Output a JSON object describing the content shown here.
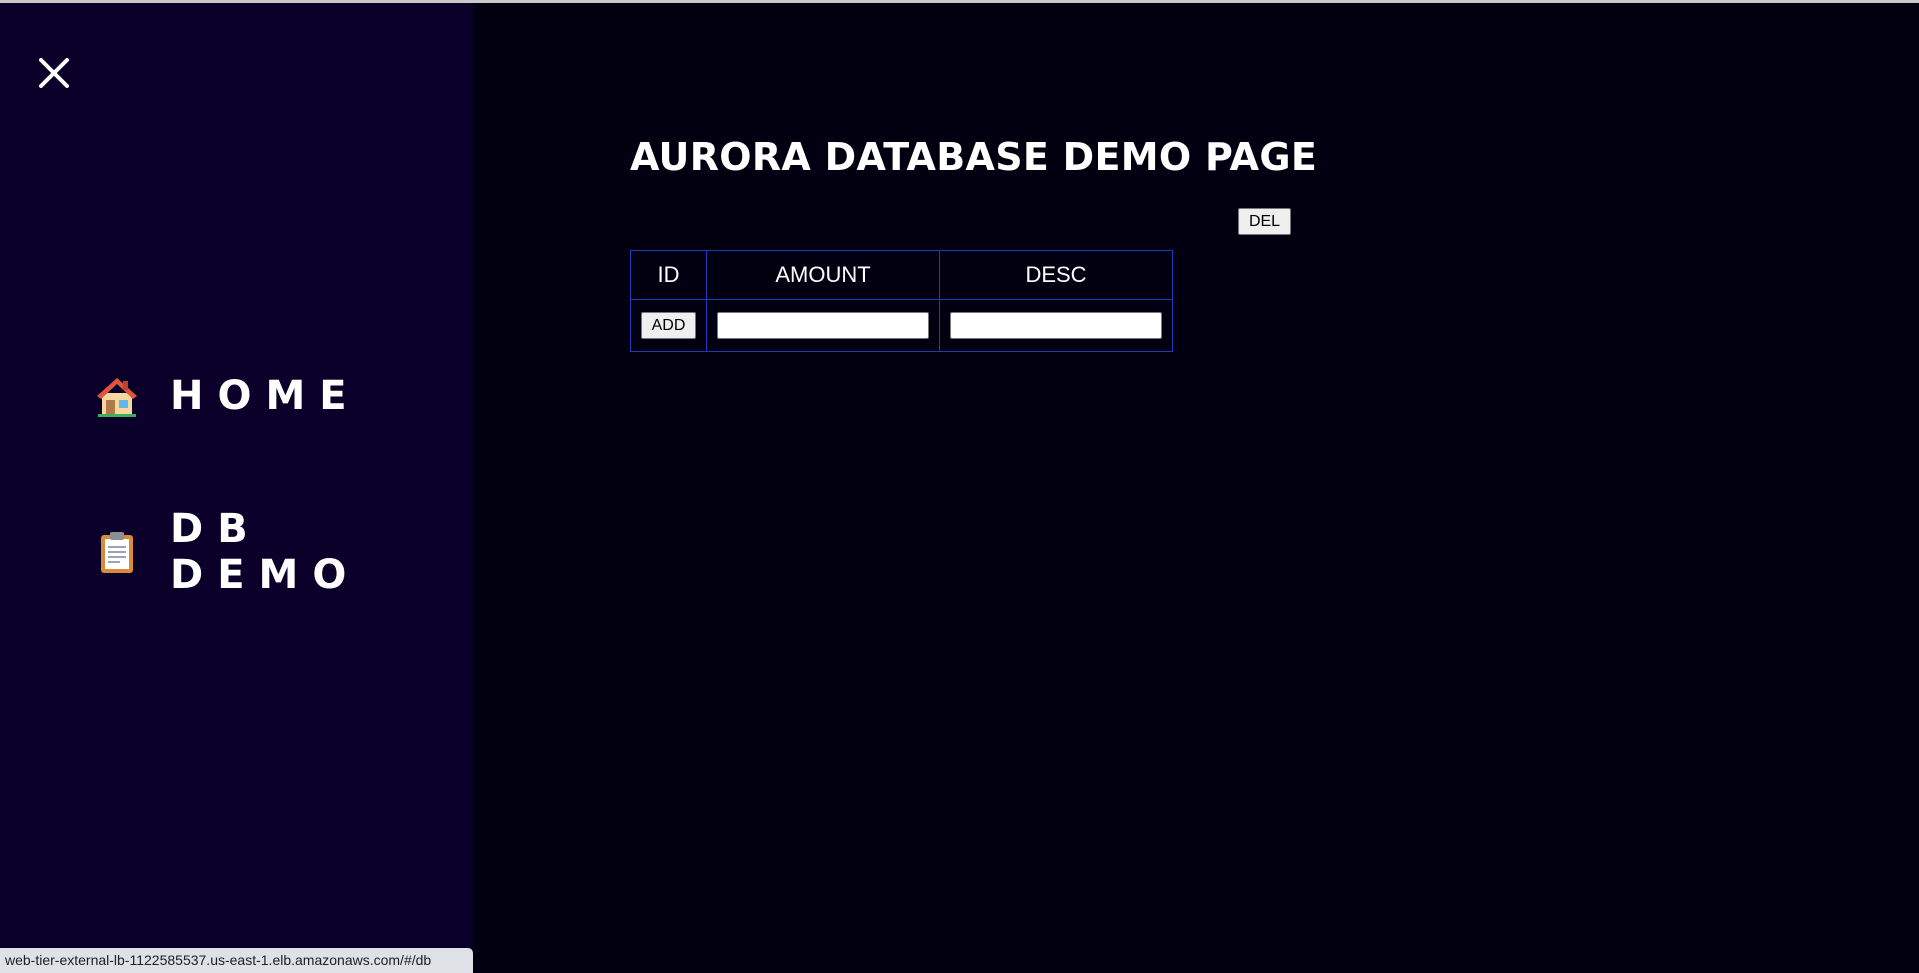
{
  "sidebar": {
    "close_icon": "close-icon",
    "items": [
      {
        "label": "HOME",
        "icon": "house-icon"
      },
      {
        "label": "DB DEMO",
        "icon": "clipboard-icon"
      }
    ]
  },
  "main": {
    "title": "AURORA DATABASE DEMO PAGE",
    "del_label": "DEL",
    "table": {
      "headers": [
        "ID",
        "AMOUNT",
        "DESC"
      ],
      "add_label": "ADD",
      "amount_value": "",
      "desc_value": ""
    }
  },
  "status_bar": {
    "url": "web-tier-external-lb-1122585537.us-east-1.elb.amazonaws.com/#/db"
  },
  "colors": {
    "sidebar_bg": "#0a0029",
    "main_bg": "#020010",
    "table_border": "#1c3bbd",
    "text": "#ffffff"
  }
}
